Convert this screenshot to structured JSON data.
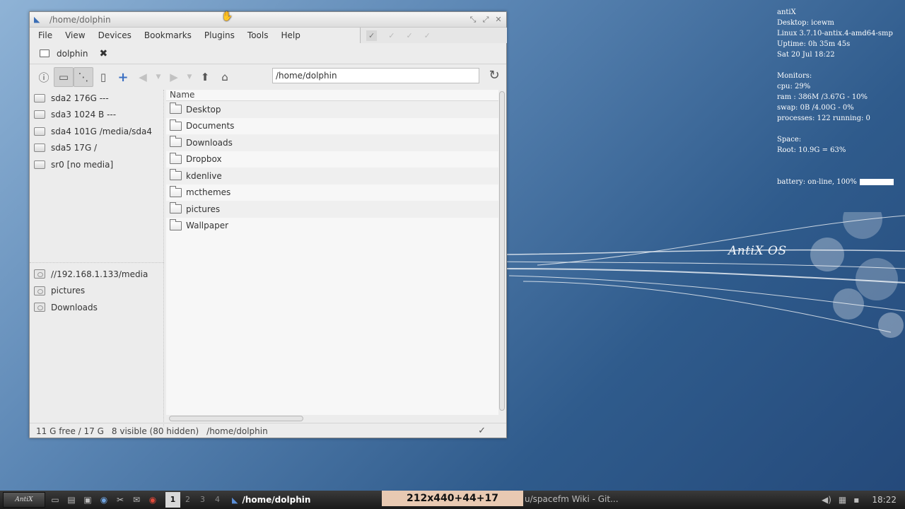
{
  "desktop": {
    "logo_text": "AntiX OS"
  },
  "conky": {
    "lines_top": [
      "antiX",
      "Desktop: icewm",
      "Linux 3.7.10-antix.4-amd64-smp",
      "Uptime: 0h 35m 45s",
      "Sat 20 Jul 18:22"
    ],
    "monitors_title": "Monitors:",
    "monitors": [
      "cpu: 29%",
      "ram : 386M /3.67G - 10%",
      "swap: 0B   /4.00G - 0%",
      "processes: 122   running: 0"
    ],
    "space_title": "Space:",
    "space": "Root: 10.9G = 63%",
    "battery": "battery: on-line, 100%",
    "battery_level_percent": 100
  },
  "window": {
    "title": "/home/dolphin",
    "menu": [
      "File",
      "View",
      "Devices",
      "Bookmarks",
      "Plugins",
      "Tools",
      "Help"
    ],
    "tab_label": "dolphin",
    "path_value": "/home/dolphin",
    "devices": [
      "sda2 176G ---",
      "sda3 1024 B ---",
      "sda4 101G /media/sda4",
      "sda5 17G /",
      "sr0 [no media]"
    ],
    "bookmarks": [
      "//192.168.1.133/media",
      "pictures",
      "Downloads"
    ],
    "column_header": "Name",
    "files": [
      "Desktop",
      "Documents",
      "Downloads",
      "Dropbox",
      "kdenlive",
      "mcthemes",
      "pictures",
      "Wallpaper"
    ],
    "status": {
      "free": "11 G free / 17 G",
      "visible": "8 visible (80 hidden)",
      "path": "/home/dolphin"
    }
  },
  "taskbar": {
    "start_label": "AntiX",
    "workspaces": [
      "1",
      "2",
      "3",
      "4"
    ],
    "active_task": "/home/dolphin",
    "geometry": "212x440+44+17",
    "other_task": "u/spacefm Wiki - Git...",
    "clock": "18:22"
  }
}
